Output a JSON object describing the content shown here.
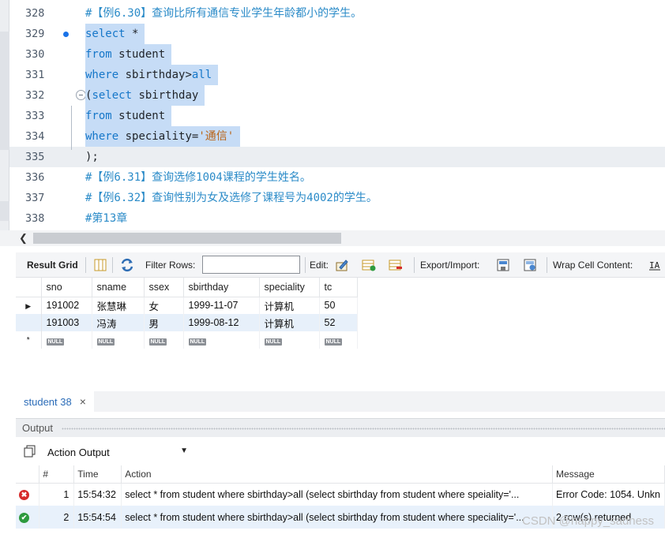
{
  "editor": {
    "lines": [
      {
        "num": "328",
        "tokens": [
          {
            "t": "#【例6.30】查询比所有通信专业学生年龄都小的学生。",
            "c": "comment"
          }
        ]
      },
      {
        "num": "329",
        "tokens": [
          {
            "t": "select",
            "c": "kw"
          },
          {
            "t": " *",
            "c": "plain"
          }
        ]
      },
      {
        "num": "330",
        "tokens": [
          {
            "t": "from",
            "c": "kw"
          },
          {
            "t": " student",
            "c": "plain"
          }
        ]
      },
      {
        "num": "331",
        "tokens": [
          {
            "t": "where",
            "c": "kw"
          },
          {
            "t": " sbirthday>",
            "c": "plain"
          },
          {
            "t": "all",
            "c": "kw"
          }
        ]
      },
      {
        "num": "332",
        "tokens": [
          {
            "t": "(",
            "c": "plain"
          },
          {
            "t": "select",
            "c": "kw"
          },
          {
            "t": " sbirthday",
            "c": "plain"
          }
        ]
      },
      {
        "num": "333",
        "tokens": [
          {
            "t": "from",
            "c": "kw"
          },
          {
            "t": " student",
            "c": "plain"
          }
        ]
      },
      {
        "num": "334",
        "tokens": [
          {
            "t": "where",
            "c": "kw"
          },
          {
            "t": " speciality=",
            "c": "plain"
          },
          {
            "t": "'通信'",
            "c": "str"
          }
        ]
      },
      {
        "num": "335",
        "tokens": [
          {
            "t": ");",
            "c": "plain"
          }
        ]
      },
      {
        "num": "336",
        "tokens": [
          {
            "t": "#【例6.31】查询选修1004课程的学生姓名。",
            "c": "comment"
          }
        ]
      },
      {
        "num": "337",
        "tokens": [
          {
            "t": "#【例6.32】查询性别为女及选修了课程号为4002的学生。",
            "c": "comment"
          }
        ]
      },
      {
        "num": "338",
        "tokens": [
          {
            "t": "#第13章",
            "c": "comment"
          }
        ]
      }
    ]
  },
  "result_toolbar": {
    "result_grid_label": "Result Grid",
    "filter_rows_label": "Filter Rows:",
    "filter_value": "",
    "edit_label": "Edit:",
    "export_import_label": "Export/Import:",
    "wrap_cell_label": "Wrap Cell Content:"
  },
  "grid": {
    "columns": [
      "sno",
      "sname",
      "ssex",
      "sbirthday",
      "speciality",
      "tc"
    ],
    "rows": [
      [
        "191002",
        "张慧琳",
        "女",
        "1999-11-07",
        "计算机",
        "50"
      ],
      [
        "191003",
        "冯涛",
        "男",
        "1999-08-12",
        "计算机",
        "52"
      ]
    ],
    "null_label": "NULL",
    "new_row_marker": "*"
  },
  "result_tab": {
    "label": "student 38",
    "close": "×"
  },
  "output": {
    "title": "Output",
    "selector_value": "Action Output",
    "columns": [
      "",
      "#",
      "Time",
      "Action",
      "Message"
    ],
    "rows": [
      {
        "status": "error",
        "num": "1",
        "time": "15:54:32",
        "action": "select * from student where sbirthday>all (select sbirthday from student where speiality='...",
        "message": "Error Code: 1054. Unkn"
      },
      {
        "status": "ok",
        "num": "2",
        "time": "15:54:54",
        "action": "select * from student where sbirthday>all (select sbirthday from student where speciality='...",
        "message": "2 row(s) returned"
      }
    ]
  },
  "watermark": "CSDN @happy_sadness",
  "colors": {
    "selection": "#c6dcf6",
    "keyword": "#1677c9",
    "comment": "#2b8bc8",
    "string": "#b96518",
    "grid_alt_row": "#e7f0fa",
    "error": "#d62b2b",
    "ok": "#2e9a3e"
  }
}
